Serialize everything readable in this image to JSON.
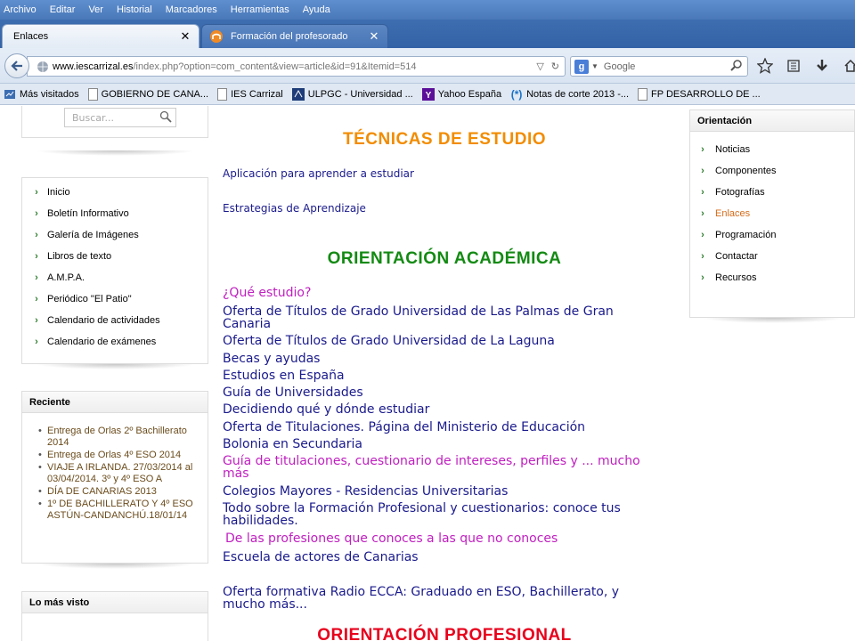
{
  "menubar": [
    "Archivo",
    "Editar",
    "Ver",
    "Historial",
    "Marcadores",
    "Herramientas",
    "Ayuda"
  ],
  "tabs": [
    {
      "label": "Enlaces",
      "active": true
    },
    {
      "label": "Formación del profesorado",
      "active": false
    }
  ],
  "url": {
    "host": "www.iescarrizal.es",
    "path": "/index.php?option=com_content&view=article&id=91&Itemid=514"
  },
  "search": {
    "placeholder": "Google"
  },
  "bookmarks": [
    {
      "label": "Más visitados",
      "icon": "most-visited-icon"
    },
    {
      "label": "GOBIERNO DE CANA...",
      "icon": "page-icon"
    },
    {
      "label": "IES Carrizal",
      "icon": "page-icon"
    },
    {
      "label": "ULPGC - Universidad ...",
      "icon": "ulpgc-icon"
    },
    {
      "label": "Yahoo España",
      "icon": "yahoo-icon"
    },
    {
      "label": "Notas de corte 2013 -...",
      "icon": "asterisk-icon"
    },
    {
      "label": "FP DESARROLLO DE ...",
      "icon": "page-icon"
    }
  ],
  "sidebar": {
    "search_placeholder": "Buscar...",
    "menu": [
      "Inicio",
      "Boletín Informativo",
      "Galería de Imágenes",
      "Libros de texto",
      "A.M.P.A.",
      "Periódico \"El Patio\"",
      "Calendario de actividades",
      "Calendario de exámenes"
    ],
    "recent_title": "Reciente",
    "recent": [
      "Entrega de Orlas 2º Bachillerato 2014",
      "Entrega de Orlas 4º ESO 2014",
      "VIAJE A IRLANDA. 27/03/2014 al 03/04/2014. 3º y 4º ESO A",
      "DÍA DE CANARIAS 2013",
      "1º DE BACHILLERATO Y 4º ESO ASTÚN-CANDANCHÚ.18/01/14"
    ],
    "most_viewed_title": "Lo más visto"
  },
  "main": {
    "tecnicas_title": "TÉCNICAS DE ESTUDIO",
    "tecnicas_links": [
      "Aplicación para aprender a estudiar",
      "Estrategias de Aprendizaje"
    ],
    "orientacion_title": "ORIENTACIÓN ACADÉMICA",
    "academic_links": [
      "¿Qué estudio?",
      "Oferta de Títulos de Grado Universidad de Las Palmas de Gran Canaria",
      "Oferta de Títulos de Grado Universidad de La Laguna",
      "Becas y ayudas",
      "Estudios en España",
      "Guía de Universidades",
      "Decidiendo qué y dónde estudiar",
      "Oferta de Titulaciones. Página del Ministerio de Educación",
      "Bolonia en Secundaria",
      "Guía de titulaciones, cuestionario de intereses, perfiles y ... mucho más",
      "Colegios Mayores - Residencias Universitarias",
      "Todo sobre la Formación Profesional y cuestionarios: conoce tus habilidades.",
      "De las profesiones que conoces a las que no conoces",
      "Escuela de actores de Canarias",
      "Oferta formativa Radio ECCA: Graduado en ESO, Bachillerato, y mucho más..."
    ],
    "profesional_title": "ORIENTACIÓN PROFESIONAL"
  },
  "right": {
    "title": "Orientación",
    "items": [
      "Noticias",
      "Componentes",
      "Fotografías",
      "Enlaces",
      "Programación",
      "Contactar",
      "Recursos"
    ],
    "active_index": 3
  },
  "colors": {
    "orange_title": "#f28c00",
    "green_title": "#138a13",
    "red_title": "#e8001c",
    "link": "#1a1a8c",
    "magenta": "#c020c0"
  }
}
